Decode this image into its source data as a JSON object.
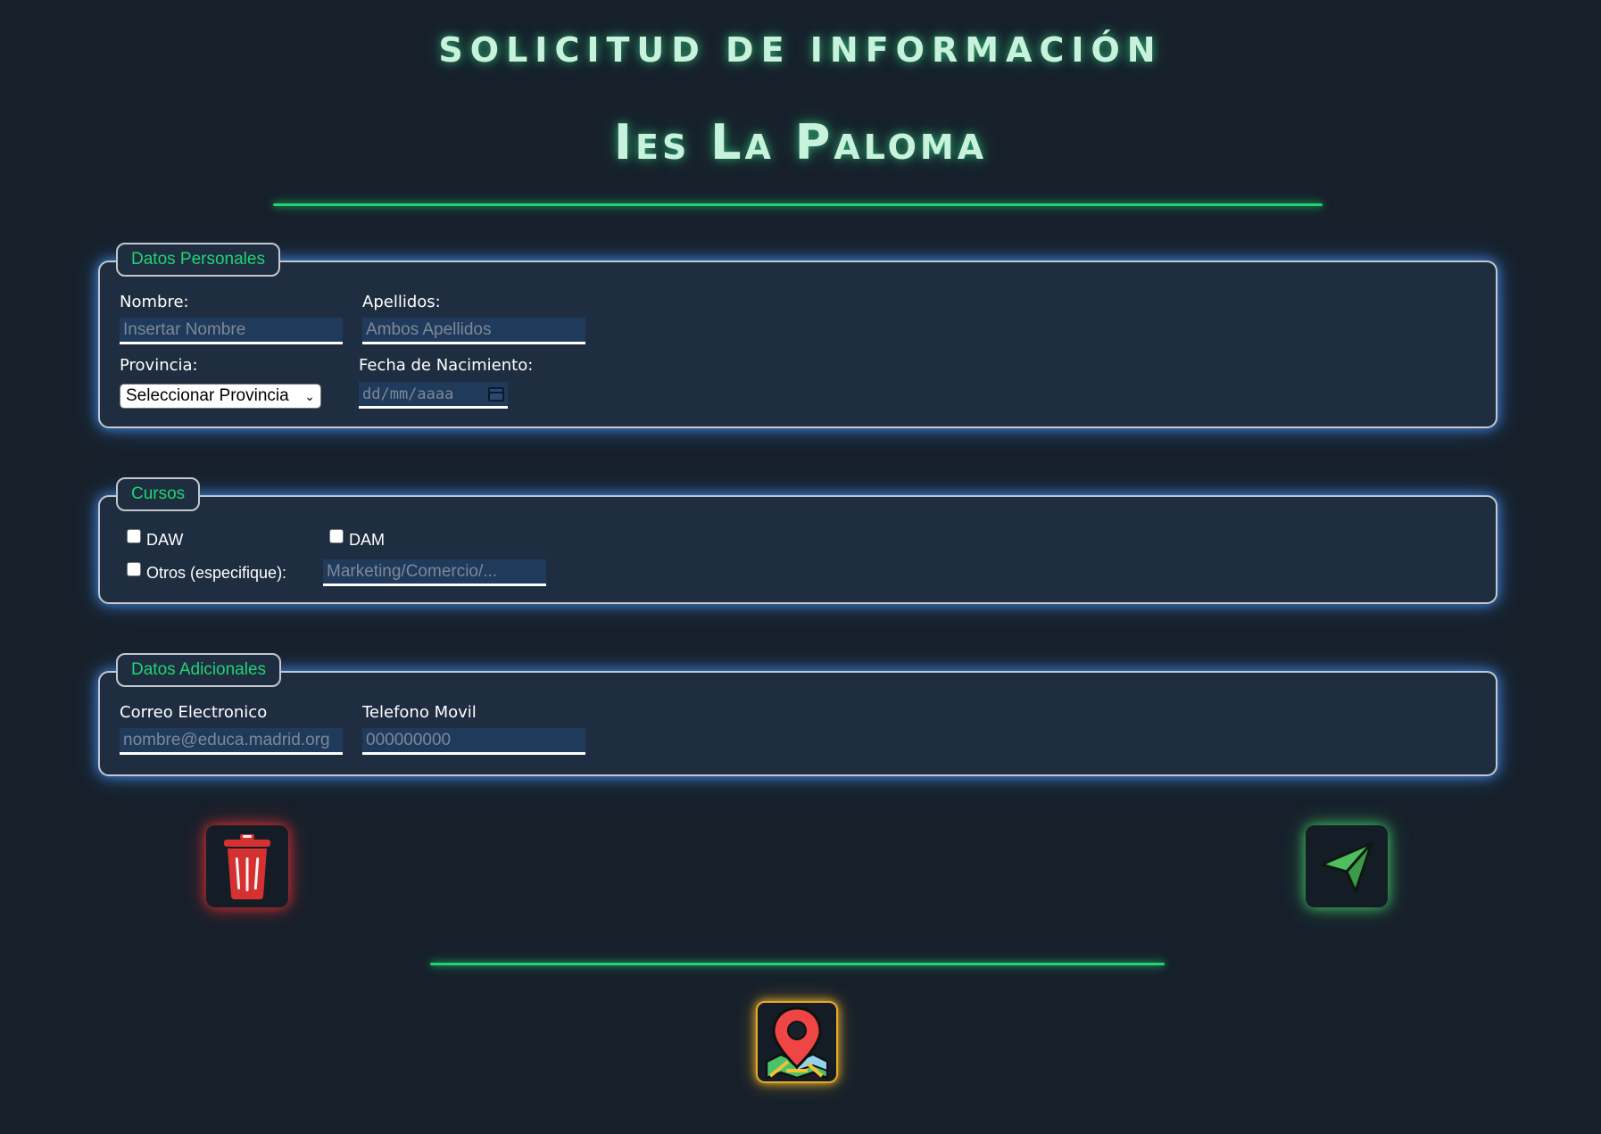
{
  "header": {
    "title": "SOLICITUD DE INFORMACIÓN",
    "school": "Ies La Paloma"
  },
  "personal": {
    "legend": "Datos Personales",
    "nombre_label": "Nombre:",
    "nombre_placeholder": "Insertar Nombre",
    "apellidos_label": "Apellidos:",
    "apellidos_placeholder": "Ambos Apellidos",
    "provincia_label": "Provincia:",
    "provincia_value": "Seleccionar Provincia",
    "fecha_label": "Fecha de Nacimiento:",
    "fecha_placeholder": "dd/mm/aaaa"
  },
  "cursos": {
    "legend": "Cursos",
    "daw_label": "DAW",
    "dam_label": "DAM",
    "otros_label": "Otros (especifique):",
    "otros_placeholder": "Marketing/Comercio/..."
  },
  "adicional": {
    "legend": "Datos Adicionales",
    "correo_label": "Correo Electronico",
    "correo_placeholder": "nombre@educa.madrid.org",
    "telefono_label": "Telefono Movil",
    "telefono_placeholder": "000000000"
  },
  "icons": {
    "delete": "trash-icon",
    "send": "paper-plane-icon",
    "map": "map-pin-icon"
  },
  "colors": {
    "background": "#17202b",
    "panel": "#1f2d40",
    "accent_green": "#1fd572",
    "glow_blue": "#4696ff",
    "delete_red": "#e03a3a"
  }
}
